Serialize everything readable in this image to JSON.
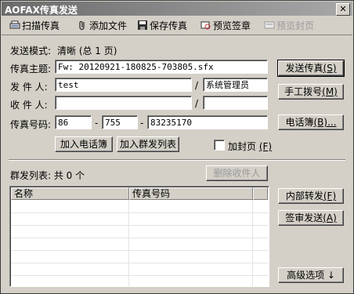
{
  "window": {
    "title": "AOFAX传真发送",
    "close_glyph": "✕"
  },
  "toolbar": {
    "scan": "扫描传真",
    "attach": "添加文件",
    "save": "保存传真",
    "preview_sign": "预览签章",
    "preview_cover": "预览封页"
  },
  "form": {
    "mode_label": "发送模式:",
    "mode_value": "清晰 (总 1 页)",
    "subject_label": "传真主题:",
    "subject_value": "Fw: 20120921-180825-703805.sfx",
    "sender_label": "发 件 人:",
    "sender_name": "test",
    "sender_dept": "系统管理员",
    "recipient_label": "收 件 人:",
    "recipient_name": "",
    "recipient_dept": "",
    "slash": "/",
    "fax_label": "传真号码:",
    "fax_country": "86",
    "fax_area": "755",
    "fax_number": "83235170",
    "dash": "-",
    "add_phonebook": "加入电话簿",
    "add_group": "加入群发列表",
    "cover_label": "加封页",
    "cover_hotkey": "(F)"
  },
  "buttons": {
    "send": "发送传真",
    "send_hotkey": "(S)",
    "manual_dial": "手工拨号",
    "manual_hotkey": "(M)",
    "phonebook": "电话簿",
    "phonebook_hotkey": "(B)...",
    "delete_recipient": "删除收件人",
    "internal_forward": "内部转发",
    "internal_hotkey": "(F)",
    "approve_send": "签审发送",
    "approve_hotkey": "(A)",
    "advanced": "高级选项 ↓"
  },
  "group": {
    "label": "群发列表: 共 0 个",
    "columns": [
      "名称",
      "传真号码"
    ]
  }
}
